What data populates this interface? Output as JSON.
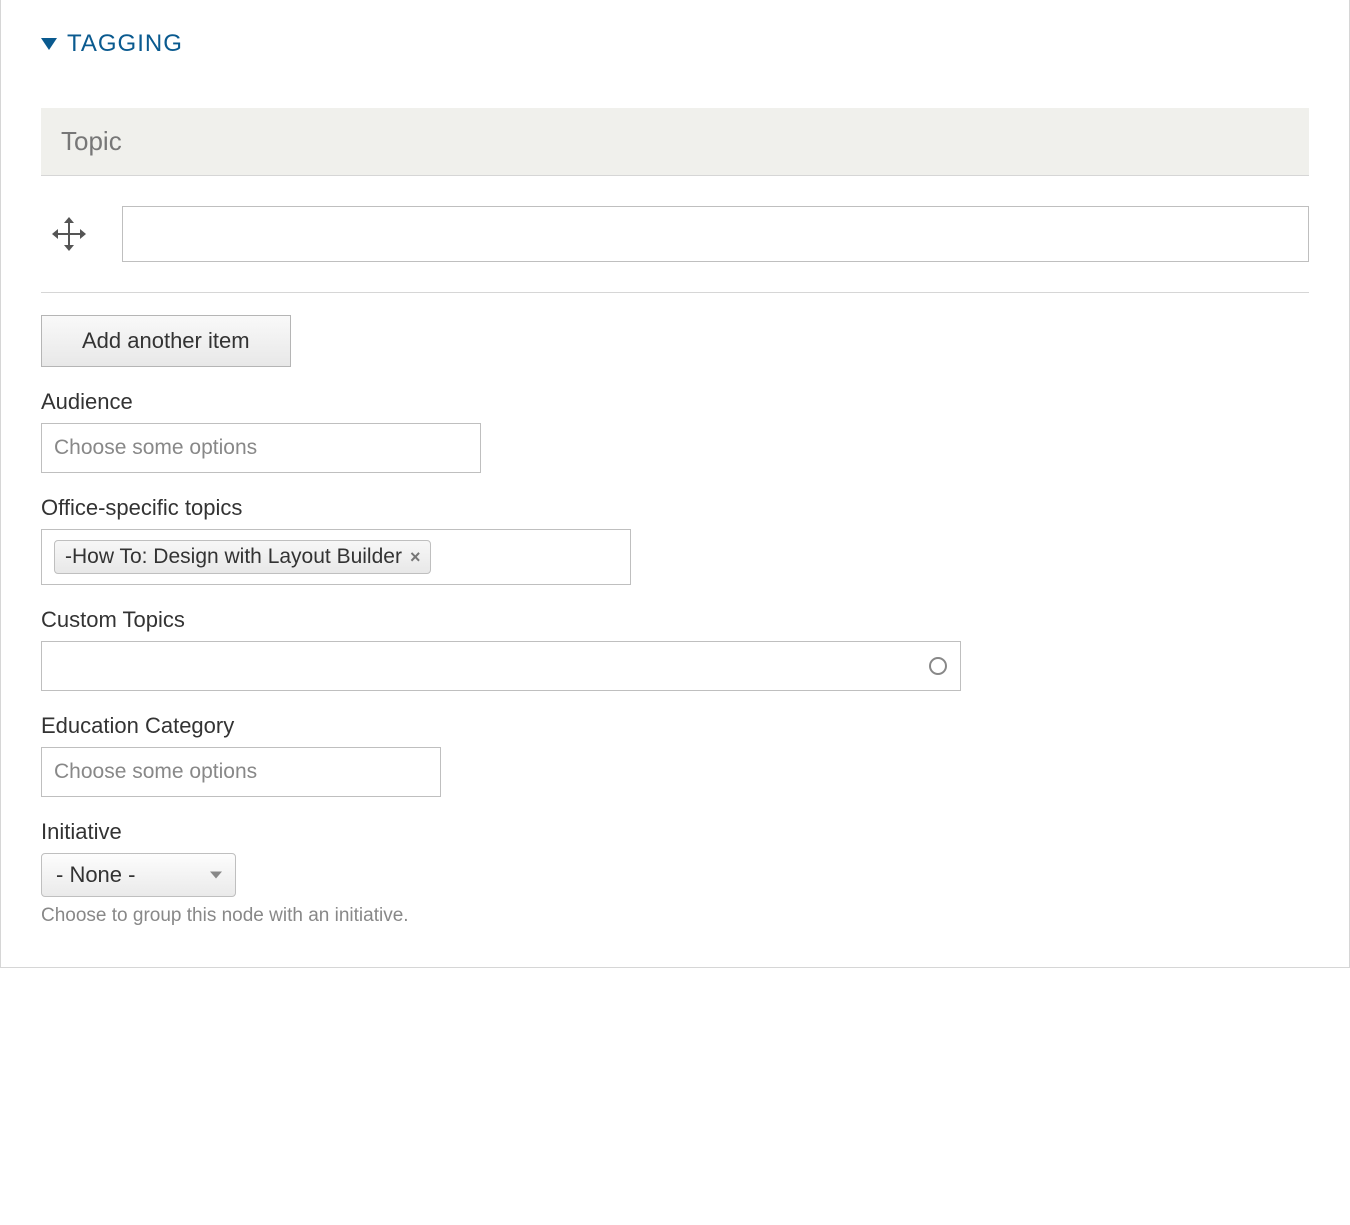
{
  "section": {
    "title": "TAGGING"
  },
  "topic": {
    "header": "Topic",
    "value": "",
    "add_button_label": "Add another item"
  },
  "audience": {
    "label": "Audience",
    "placeholder": "Choose some options"
  },
  "office_topics": {
    "label": "Office-specific topics",
    "selected": "-How To: Design with Layout Builder"
  },
  "custom_topics": {
    "label": "Custom Topics",
    "value": ""
  },
  "education_category": {
    "label": "Education Category",
    "placeholder": "Choose some options"
  },
  "initiative": {
    "label": "Initiative",
    "selected": "- None -",
    "help": "Choose to group this node with an initiative."
  }
}
